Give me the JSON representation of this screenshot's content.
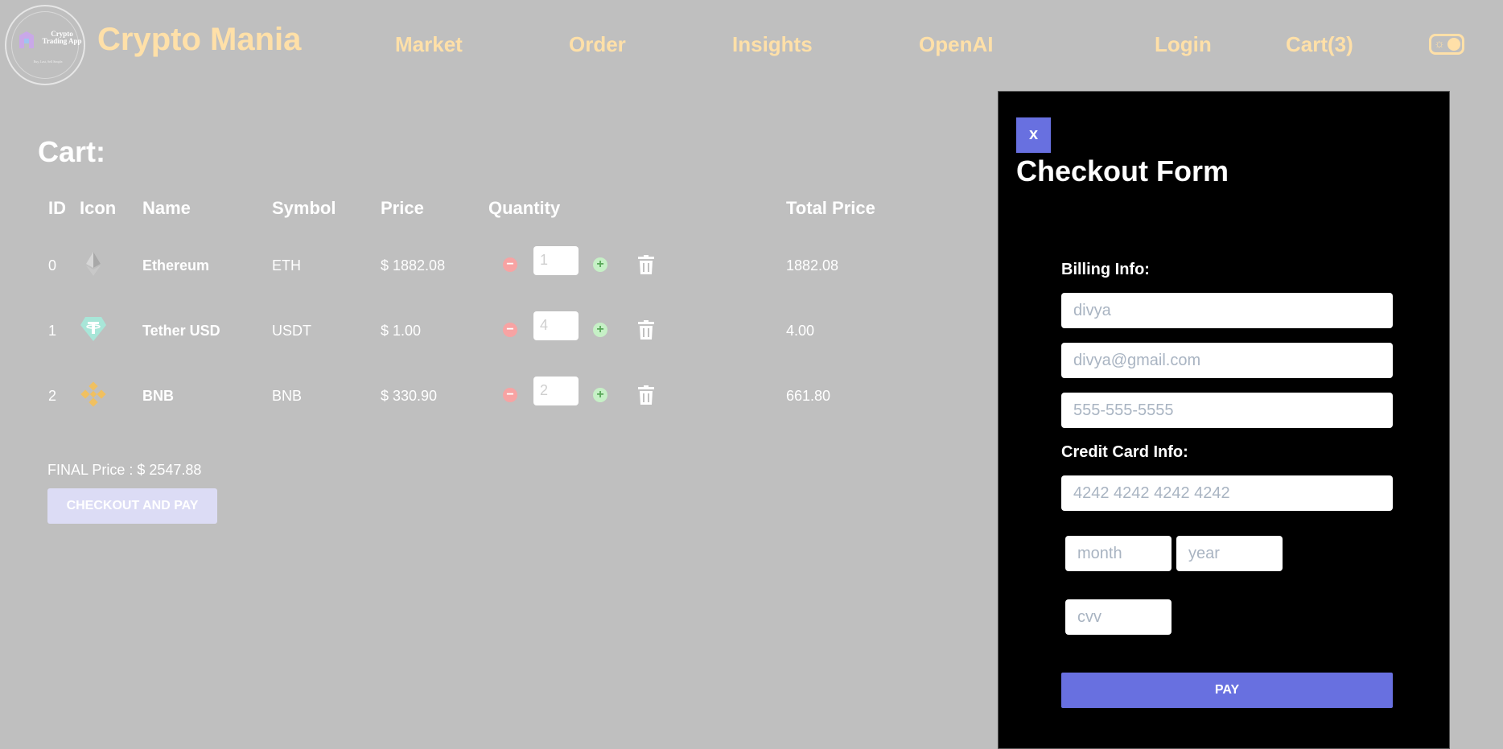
{
  "header": {
    "logo_title": "Crypto Trading App",
    "logo_tagline": "Buy, Last, Sell Simple.",
    "brand": "Crypto Mania",
    "nav": [
      "Market",
      "Order",
      "Insights",
      "OpenAI"
    ],
    "login": "Login",
    "cart": "Cart(3)"
  },
  "cart": {
    "title": "Cart:",
    "columns": [
      "ID",
      "Icon",
      "Name",
      "Symbol",
      "Price",
      "Quantity",
      "Total Price"
    ],
    "rows": [
      {
        "id": "0",
        "icon": "ethereum-icon",
        "name": "Ethereum",
        "symbol": "ETH",
        "price": "$ 1882.08",
        "qty": "1",
        "total": "1882.08"
      },
      {
        "id": "1",
        "icon": "tether-icon",
        "name": "Tether USD",
        "symbol": "USDT",
        "price": "$ 1.00",
        "qty": "4",
        "total": "4.00"
      },
      {
        "id": "2",
        "icon": "bnb-icon",
        "name": "BNB",
        "symbol": "BNB",
        "price": "$ 330.90",
        "qty": "2",
        "total": "661.80"
      }
    ],
    "final_price": "FINAL Price : $ 2547.88",
    "checkout_label": "CHECKOUT AND PAY"
  },
  "checkout": {
    "close_label": "x",
    "title": "Checkout Form",
    "billing_label": "Billing Info:",
    "name_value": "divya",
    "email_value": "divya@gmail.com",
    "phone_placeholder": "555-555-5555",
    "card_label": "Credit Card Info:",
    "card_placeholder": "4242 4242 4242 4242",
    "month_placeholder": "month",
    "year_placeholder": "year",
    "cvv_placeholder": "cvv",
    "pay_label": "PAY"
  },
  "colors": {
    "background": "#bfbfbf",
    "brand": "#ffe0a8",
    "accent": "#6870e0",
    "modal": "#000000"
  }
}
